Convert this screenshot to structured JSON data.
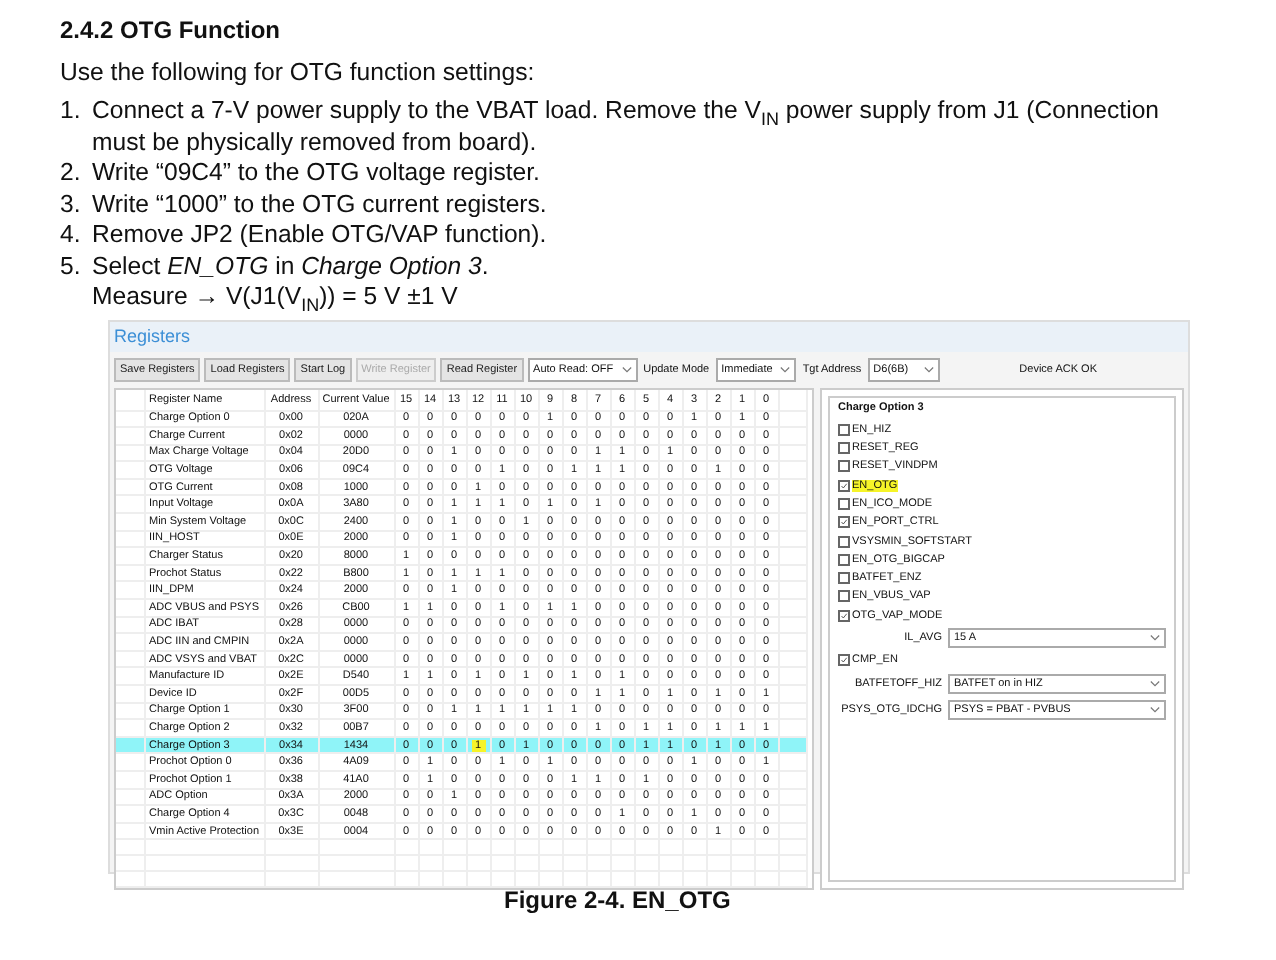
{
  "heading": "2.4.2 OTG Function",
  "intro": "Use the following for OTG function settings:",
  "steps": [
    {
      "number": "1.",
      "text": "Connect a 7-V power supply to the VBAT load. Remove the V$_{IN}$ power supply from J1 (Connection must be physically removed from board)."
    },
    {
      "number": "2.",
      "text": "Write “09C4” to the OTG voltage register."
    },
    {
      "number": "3.",
      "text": "Write “1000” to the OTG current registers."
    },
    {
      "number": "4.",
      "text": "Remove JP2 (Enable OTG/VAP function)."
    },
    {
      "number": "5.",
      "text": "Select *EN_OTG* in *Charge Option 3*.",
      "extra": "Measure → V(J1(V$_{IN}$)) = 5 V ±1 V"
    }
  ],
  "app": {
    "title": "Registers",
    "toolbar": [
      {
        "kind": "button",
        "label": "Save Registers",
        "disabled": false
      },
      {
        "kind": "button",
        "label": "Load Registers",
        "disabled": false
      },
      {
        "kind": "button",
        "label": "Start Log",
        "disabled": false
      },
      {
        "kind": "button",
        "label": "Write Register",
        "disabled": true
      },
      {
        "kind": "button",
        "label": "Read Register",
        "disabled": false
      },
      {
        "kind": "select",
        "label": "Auto Read: OFF"
      },
      {
        "kind": "label",
        "label": "Update Mode"
      },
      {
        "kind": "select",
        "label": "Immediate"
      },
      {
        "kind": "label",
        "label": "Tgt Address"
      },
      {
        "kind": "select",
        "label": "D6(6B)"
      }
    ],
    "status": "Device ACK OK",
    "table": {
      "columns": [
        "Register Name",
        "Address",
        "Current Value"
      ],
      "bit_columns": [
        "15",
        "14",
        "13",
        "12",
        "11",
        "10",
        "9",
        "8",
        "7",
        "6",
        "5",
        "4",
        "3",
        "2",
        "1",
        "0"
      ],
      "rows": [
        {
          "name": "Charge Option 0",
          "address": "0x00",
          "value": "020A",
          "bits": [
            "0",
            "0",
            "0",
            "0",
            "0",
            "0",
            "1",
            "0",
            "0",
            "0",
            "0",
            "0",
            "1",
            "0",
            "1",
            "0"
          ],
          "selected": false
        },
        {
          "name": "Charge Current",
          "address": "0x02",
          "value": "0000",
          "bits": [
            "0",
            "0",
            "0",
            "0",
            "0",
            "0",
            "0",
            "0",
            "0",
            "0",
            "0",
            "0",
            "0",
            "0",
            "0",
            "0"
          ],
          "selected": false
        },
        {
          "name": "Max Charge Voltage",
          "address": "0x04",
          "value": "20D0",
          "bits": [
            "0",
            "0",
            "1",
            "0",
            "0",
            "0",
            "0",
            "0",
            "1",
            "1",
            "0",
            "1",
            "0",
            "0",
            "0",
            "0"
          ],
          "selected": false
        },
        {
          "name": "OTG Voltage",
          "address": "0x06",
          "value": "09C4",
          "bits": [
            "0",
            "0",
            "0",
            "0",
            "1",
            "0",
            "0",
            "1",
            "1",
            "1",
            "0",
            "0",
            "0",
            "1",
            "0",
            "0"
          ],
          "selected": false
        },
        {
          "name": "OTG Current",
          "address": "0x08",
          "value": "1000",
          "bits": [
            "0",
            "0",
            "0",
            "1",
            "0",
            "0",
            "0",
            "0",
            "0",
            "0",
            "0",
            "0",
            "0",
            "0",
            "0",
            "0"
          ],
          "selected": false
        },
        {
          "name": "Input Voltage",
          "address": "0x0A",
          "value": "3A80",
          "bits": [
            "0",
            "0",
            "1",
            "1",
            "1",
            "0",
            "1",
            "0",
            "1",
            "0",
            "0",
            "0",
            "0",
            "0",
            "0",
            "0"
          ],
          "selected": false
        },
        {
          "name": "Min System Voltage",
          "address": "0x0C",
          "value": "2400",
          "bits": [
            "0",
            "0",
            "1",
            "0",
            "0",
            "1",
            "0",
            "0",
            "0",
            "0",
            "0",
            "0",
            "0",
            "0",
            "0",
            "0"
          ],
          "selected": false
        },
        {
          "name": "IIN_HOST",
          "address": "0x0E",
          "value": "2000",
          "bits": [
            "0",
            "0",
            "1",
            "0",
            "0",
            "0",
            "0",
            "0",
            "0",
            "0",
            "0",
            "0",
            "0",
            "0",
            "0",
            "0"
          ],
          "selected": false
        },
        {
          "name": "Charger Status",
          "address": "0x20",
          "value": "8000",
          "bits": [
            "1",
            "0",
            "0",
            "0",
            "0",
            "0",
            "0",
            "0",
            "0",
            "0",
            "0",
            "0",
            "0",
            "0",
            "0",
            "0"
          ],
          "selected": false
        },
        {
          "name": "Prochot Status",
          "address": "0x22",
          "value": "B800",
          "bits": [
            "1",
            "0",
            "1",
            "1",
            "1",
            "0",
            "0",
            "0",
            "0",
            "0",
            "0",
            "0",
            "0",
            "0",
            "0",
            "0"
          ],
          "selected": false
        },
        {
          "name": "IIN_DPM",
          "address": "0x24",
          "value": "2000",
          "bits": [
            "0",
            "0",
            "1",
            "0",
            "0",
            "0",
            "0",
            "0",
            "0",
            "0",
            "0",
            "0",
            "0",
            "0",
            "0",
            "0"
          ],
          "selected": false
        },
        {
          "name": "ADC VBUS and PSYS",
          "address": "0x26",
          "value": "CB00",
          "bits": [
            "1",
            "1",
            "0",
            "0",
            "1",
            "0",
            "1",
            "1",
            "0",
            "0",
            "0",
            "0",
            "0",
            "0",
            "0",
            "0"
          ],
          "selected": false
        },
        {
          "name": "ADC IBAT",
          "address": "0x28",
          "value": "0000",
          "bits": [
            "0",
            "0",
            "0",
            "0",
            "0",
            "0",
            "0",
            "0",
            "0",
            "0",
            "0",
            "0",
            "0",
            "0",
            "0",
            "0"
          ],
          "selected": false
        },
        {
          "name": "ADC IIN and CMPIN",
          "address": "0x2A",
          "value": "0000",
          "bits": [
            "0",
            "0",
            "0",
            "0",
            "0",
            "0",
            "0",
            "0",
            "0",
            "0",
            "0",
            "0",
            "0",
            "0",
            "0",
            "0"
          ],
          "selected": false
        },
        {
          "name": "ADC VSYS and VBAT",
          "address": "0x2C",
          "value": "0000",
          "bits": [
            "0",
            "0",
            "0",
            "0",
            "0",
            "0",
            "0",
            "0",
            "0",
            "0",
            "0",
            "0",
            "0",
            "0",
            "0",
            "0"
          ],
          "selected": false
        },
        {
          "name": "Manufacture ID",
          "address": "0x2E",
          "value": "D540",
          "bits": [
            "1",
            "1",
            "0",
            "1",
            "0",
            "1",
            "0",
            "1",
            "0",
            "1",
            "0",
            "0",
            "0",
            "0",
            "0",
            "0"
          ],
          "selected": false
        },
        {
          "name": "Device ID",
          "address": "0x2F",
          "value": "00D5",
          "bits": [
            "0",
            "0",
            "0",
            "0",
            "0",
            "0",
            "0",
            "0",
            "1",
            "1",
            "0",
            "1",
            "0",
            "1",
            "0",
            "1"
          ],
          "selected": false
        },
        {
          "name": "Charge Option 1",
          "address": "0x30",
          "value": "3F00",
          "bits": [
            "0",
            "0",
            "1",
            "1",
            "1",
            "1",
            "1",
            "1",
            "0",
            "0",
            "0",
            "0",
            "0",
            "0",
            "0",
            "0"
          ],
          "selected": false
        },
        {
          "name": "Charge Option 2",
          "address": "0x32",
          "value": "00B7",
          "bits": [
            "0",
            "0",
            "0",
            "0",
            "0",
            "0",
            "0",
            "0",
            "1",
            "0",
            "1",
            "1",
            "0",
            "1",
            "1",
            "1"
          ],
          "selected": false
        },
        {
          "name": "Charge Option 3",
          "address": "0x34",
          "value": "1434",
          "bits": [
            "0",
            "0",
            "0",
            "1",
            "0",
            "1",
            "0",
            "0",
            "0",
            "0",
            "1",
            "1",
            "0",
            "1",
            "0",
            "0"
          ],
          "selected": true,
          "marked_bits": [
            false,
            false,
            false,
            true,
            false,
            false,
            false,
            false,
            false,
            false,
            false,
            false,
            false,
            false,
            false,
            false
          ]
        },
        {
          "name": "Prochot Option 0",
          "address": "0x36",
          "value": "4A09",
          "bits": [
            "0",
            "1",
            "0",
            "0",
            "1",
            "0",
            "1",
            "0",
            "0",
            "0",
            "0",
            "0",
            "1",
            "0",
            "0",
            "1"
          ],
          "selected": false
        },
        {
          "name": "Prochot Option 1",
          "address": "0x38",
          "value": "41A0",
          "bits": [
            "0",
            "1",
            "0",
            "0",
            "0",
            "0",
            "0",
            "1",
            "1",
            "0",
            "1",
            "0",
            "0",
            "0",
            "0",
            "0"
          ],
          "selected": false
        },
        {
          "name": "ADC Option",
          "address": "0x3A",
          "value": "2000",
          "bits": [
            "0",
            "0",
            "1",
            "0",
            "0",
            "0",
            "0",
            "0",
            "0",
            "0",
            "0",
            "0",
            "0",
            "0",
            "0",
            "0"
          ],
          "selected": false
        },
        {
          "name": "Charge Option 4",
          "address": "0x3C",
          "value": "0048",
          "bits": [
            "0",
            "0",
            "0",
            "0",
            "0",
            "0",
            "0",
            "0",
            "0",
            "1",
            "0",
            "0",
            "1",
            "0",
            "0",
            "0"
          ],
          "selected": false
        },
        {
          "name": "Vmin Active Protection",
          "address": "0x3E",
          "value": "0004",
          "bits": [
            "0",
            "0",
            "0",
            "0",
            "0",
            "0",
            "0",
            "0",
            "0",
            "0",
            "0",
            "0",
            "0",
            "1",
            "0",
            "0"
          ],
          "selected": false
        }
      ]
    },
    "group": {
      "title": "Charge Option 3",
      "fields": [
        {
          "kind": "checkbox",
          "label": "EN_HIZ",
          "checked": false,
          "highlighted": false
        },
        {
          "kind": "checkbox",
          "label": "RESET_REG",
          "checked": false,
          "highlighted": false
        },
        {
          "kind": "checkbox",
          "label": "RESET_VINDPM",
          "checked": false,
          "highlighted": false
        },
        {
          "kind": "checkbox",
          "label": "EN_OTG",
          "checked": true,
          "highlighted": true
        },
        {
          "kind": "checkbox",
          "label": "EN_ICO_MODE",
          "checked": false,
          "highlighted": false
        },
        {
          "kind": "checkbox",
          "label": "EN_PORT_CTRL",
          "checked": true,
          "highlighted": false
        },
        {
          "kind": "checkbox",
          "label": "VSYSMIN_SOFTSTART",
          "checked": false,
          "highlighted": false
        },
        {
          "kind": "checkbox",
          "label": "EN_OTG_BIGCAP",
          "checked": false,
          "highlighted": false
        },
        {
          "kind": "checkbox",
          "label": "BATFET_ENZ",
          "checked": false,
          "highlighted": false
        },
        {
          "kind": "checkbox",
          "label": "EN_VBUS_VAP",
          "checked": false,
          "highlighted": false
        },
        {
          "kind": "checkbox",
          "label": "OTG_VAP_MODE",
          "checked": true,
          "highlighted": false
        },
        {
          "kind": "select",
          "label": "IL_AVG",
          "value": "15 A"
        },
        {
          "kind": "checkbox",
          "label": "CMP_EN",
          "checked": true,
          "highlighted": false
        },
        {
          "kind": "select",
          "label": "BATFETOFF_HIZ",
          "value": "BATFET on in HIZ"
        },
        {
          "kind": "select",
          "label": "PSYS_OTG_IDCHG",
          "value": "PSYS = PBAT - PVBUS"
        }
      ]
    }
  },
  "caption": "Figure 2-4. EN_OTG"
}
